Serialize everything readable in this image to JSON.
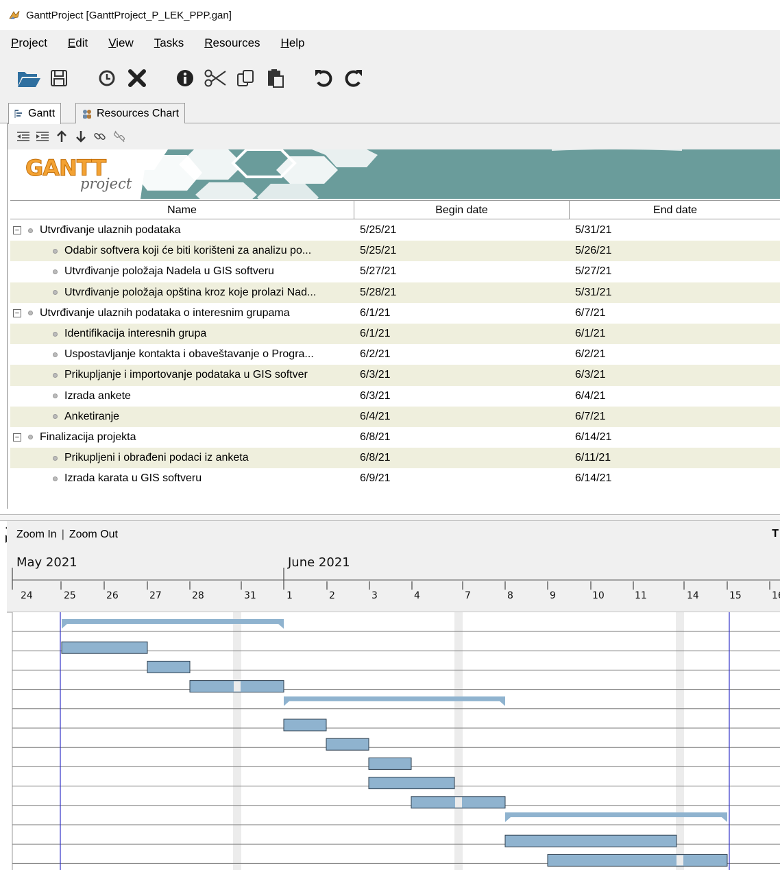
{
  "window": {
    "title": "GanttProject [GanttProject_P_LEK_PPP.gan]"
  },
  "menu": [
    {
      "label": "Project",
      "mnemonic": "P",
      "rest": "roject"
    },
    {
      "label": "Edit",
      "mnemonic": "E",
      "rest": "dit"
    },
    {
      "label": "View",
      "mnemonic": "V",
      "rest": "iew"
    },
    {
      "label": "Tasks",
      "mnemonic": "T",
      "rest": "asks"
    },
    {
      "label": "Resources",
      "mnemonic": "R",
      "rest": "esources"
    },
    {
      "label": "Help",
      "mnemonic": "H",
      "rest": "elp"
    }
  ],
  "toolbar": {
    "icons": [
      "open-icon",
      "save-icon",
      "history-icon",
      "delete-icon",
      "info-icon",
      "cut-icon",
      "copy-icon",
      "paste-icon",
      "undo-icon",
      "redo-icon"
    ]
  },
  "tabs": [
    {
      "label": "Gantt",
      "icon": "gantt-tab-icon",
      "active": true
    },
    {
      "label": "Resources Chart",
      "icon": "resources-tab-icon",
      "active": false
    }
  ],
  "subtoolbar": {
    "icons": [
      "outdent-icon",
      "indent-icon",
      "move-up-icon",
      "move-down-icon",
      "link-icon",
      "unlink-icon"
    ]
  },
  "logo": {
    "main": "GANTT",
    "sub": "project"
  },
  "table": {
    "columns": [
      "Name",
      "Begin date",
      "End date"
    ],
    "rows": [
      {
        "name": "Utvrđivanje ulaznih podataka",
        "begin": "5/25/21",
        "end": "5/31/21",
        "level": 0,
        "summary": true
      },
      {
        "name": "Odabir softvera koji će biti korišteni za analizu po...",
        "begin": "5/25/21",
        "end": "5/26/21",
        "level": 1,
        "summary": false
      },
      {
        "name": "Utvrđivanje položaja Nadela  u GIS softveru",
        "begin": "5/27/21",
        "end": "5/27/21",
        "level": 1,
        "summary": false
      },
      {
        "name": "Utvrđivanje položaja opština kroz koje prolazi Nad...",
        "begin": "5/28/21",
        "end": "5/31/21",
        "level": 1,
        "summary": false
      },
      {
        "name": "Utvrđivanje ulaznih podataka o interesnim grupama",
        "begin": "6/1/21",
        "end": "6/7/21",
        "level": 0,
        "summary": true
      },
      {
        "name": "Identifikacija interesnih grupa",
        "begin": "6/1/21",
        "end": "6/1/21",
        "level": 1,
        "summary": false
      },
      {
        "name": "Uspostavljanje kontakta i obaveštavanje o Progra...",
        "begin": "6/2/21",
        "end": "6/2/21",
        "level": 1,
        "summary": false
      },
      {
        "name": "Prikupljanje i importovanje podataka u GIS softver",
        "begin": "6/3/21",
        "end": "6/3/21",
        "level": 1,
        "summary": false
      },
      {
        "name": "Izrada ankete",
        "begin": "6/3/21",
        "end": "6/4/21",
        "level": 1,
        "summary": false
      },
      {
        "name": "Anketiranje",
        "begin": "6/4/21",
        "end": "6/7/21",
        "level": 1,
        "summary": false
      },
      {
        "name": "Finalizacija projekta",
        "begin": "6/8/21",
        "end": "6/14/21",
        "level": 0,
        "summary": true
      },
      {
        "name": "Prikupljeni i obrađeni podaci iz anketa",
        "begin": "6/8/21",
        "end": "6/11/21",
        "level": 1,
        "summary": false
      },
      {
        "name": "Izrada karata u GIS softveru",
        "begin": "6/9/21",
        "end": "6/14/21",
        "level": 1,
        "summary": false
      }
    ]
  },
  "chart": {
    "zoom_in": "Zoom In",
    "separator": "|",
    "zoom_out": "Zoom Out",
    "corner_text": "T",
    "months": [
      {
        "label": "May 2021",
        "first_day": "24"
      },
      {
        "label": "June 2021",
        "first_day": "1"
      }
    ],
    "days": [
      "24",
      "25",
      "26",
      "27",
      "28",
      "31",
      "1",
      "2",
      "3",
      "4",
      "7",
      "8",
      "9",
      "10",
      "11",
      "14",
      "15",
      "16"
    ],
    "weekends": [
      "29",
      "5",
      "12"
    ],
    "today_markers": [
      "25",
      "15"
    ],
    "bars": [
      {
        "start": "25",
        "end": "1",
        "summary": true
      },
      {
        "start": "25",
        "end": "27",
        "summary": false
      },
      {
        "start": "27",
        "end": "28",
        "summary": false
      },
      {
        "start": "28",
        "end": "1",
        "summary": false
      },
      {
        "start": "1",
        "end": "8",
        "summary": true
      },
      {
        "start": "1",
        "end": "2",
        "summary": false
      },
      {
        "start": "2",
        "end": "3",
        "summary": false
      },
      {
        "start": "3",
        "end": "4",
        "summary": false
      },
      {
        "start": "3",
        "end": "7",
        "summary": false
      },
      {
        "start": "4",
        "end": "8",
        "summary": false
      },
      {
        "start": "8",
        "end": "15",
        "summary": true
      },
      {
        "start": "8",
        "end": "14",
        "summary": false
      },
      {
        "start": "9",
        "end": "15",
        "summary": false
      }
    ],
    "colors": {
      "bar": "#8fb3cf",
      "bar_border": "#2e3f4f",
      "weekend": "#ececec",
      "marker": "#3232c8",
      "summary": "#8fb3cf"
    }
  }
}
